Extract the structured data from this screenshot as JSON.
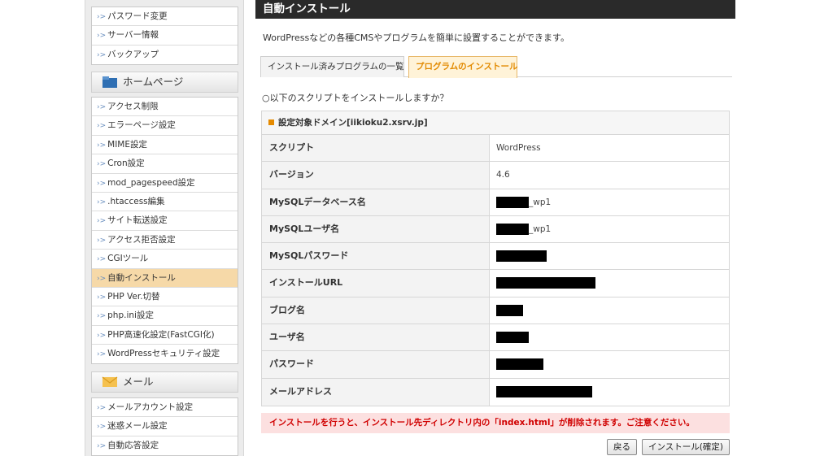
{
  "sidebar": {
    "group1": [
      "パスワード変更",
      "サーバー情報",
      "バックアップ"
    ],
    "homepage_title": "ホームページ",
    "group2": [
      "アクセス制限",
      "エラーページ設定",
      "MIME設定",
      "Cron設定",
      "mod_pagespeed設定",
      ".htaccess編集",
      "サイト転送設定",
      "アクセス拒否設定",
      "CGIツール",
      "自動インストール",
      "PHP Ver.切替",
      "php.ini設定",
      "PHP高速化設定(FastCGI化)",
      "WordPressセキュリティ設定"
    ],
    "active_item": "自動インストール",
    "mail_title": "メール",
    "group3": [
      "メールアカウント設定",
      "迷惑メール設定",
      "自動応答設定"
    ],
    "arrow": "›>",
    "colors": {
      "active_bg": "#f6d9a8",
      "mail_icon": "#f5c14f",
      "homepage_icon": "#2f6fb3"
    }
  },
  "main": {
    "title": "自動インストール",
    "intro": "WordPressなどの各種CMSやプログラムを簡単に設置することができます。",
    "tabs": [
      "インストール済みプログラムの一覧",
      "プログラムのインストール"
    ],
    "question": "○以下のスクリプトをインストールしますか？",
    "domain_label": "設定対象ドメイン[iikioku2.xsrv.jp]",
    "rows": [
      {
        "key": "スクリプト",
        "value": "WordPress"
      },
      {
        "key": "バージョン",
        "value": "4.6"
      },
      {
        "key": "MySQLデータベース名",
        "value": "_wp1",
        "redacted": true
      },
      {
        "key": "MySQLユーザ名",
        "value": "_wp1",
        "redacted": true
      },
      {
        "key": "MySQLパスワード",
        "value": "",
        "redacted": true
      },
      {
        "key": "インストールURL",
        "value": "",
        "redacted": true
      },
      {
        "key": "ブログ名",
        "value": "",
        "redacted": true
      },
      {
        "key": "ユーザ名",
        "value": "",
        "redacted": true
      },
      {
        "key": "パスワード",
        "value": "",
        "redacted": true
      },
      {
        "key": "メールアドレス",
        "value": "",
        "redacted": true
      }
    ],
    "warning": "インストールを行うと、インストール先ディレクトリ内の「index.html」が削除されます。ご注意ください。",
    "back_button": "戻る",
    "install_button": "インストール(確定)",
    "colors": {
      "title_bg": "#2a2a2a",
      "tab_active": "#e28a00",
      "warn_text": "#d00000",
      "warn_bg": "#fce0e0"
    }
  }
}
